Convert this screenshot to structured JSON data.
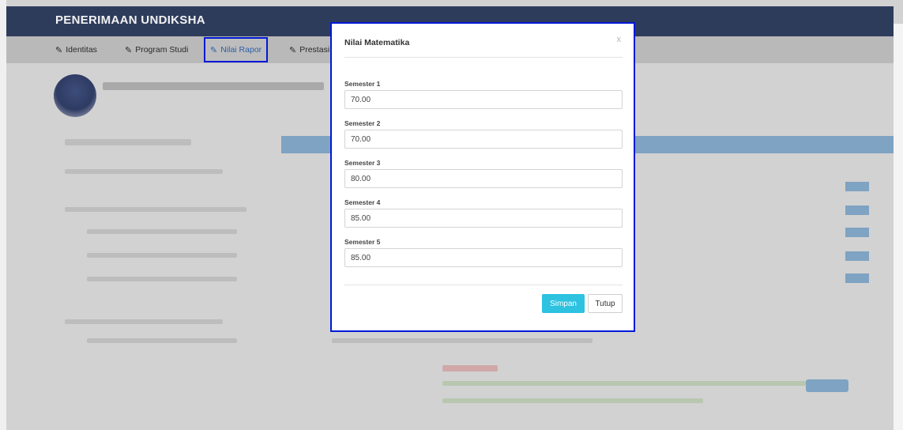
{
  "app": {
    "title": "PENERIMAAN UNDIKSHA"
  },
  "nav": {
    "items": [
      {
        "label": "Identitas",
        "icon": "pencil-icon"
      },
      {
        "label": "Program Studi",
        "icon": "pencil-icon"
      },
      {
        "label": "Nilai Rapor",
        "icon": "pencil-icon",
        "active": true
      },
      {
        "label": "Prestasi",
        "icon": "pencil-icon"
      }
    ]
  },
  "modal": {
    "title": "Nilai Matematika",
    "close_label": "x",
    "fields": [
      {
        "label": "Semester 1",
        "value": "70.00"
      },
      {
        "label": "Semester 2",
        "value": "70.00"
      },
      {
        "label": "Semester 3",
        "value": "80.00"
      },
      {
        "label": "Semester 4",
        "value": "85.00"
      },
      {
        "label": "Semester 5",
        "value": "85.00"
      }
    ],
    "save_label": "Simpan",
    "cancel_label": "Tutup"
  },
  "colors": {
    "navbar": "#2e3c5c",
    "active_outline": "#0018d6",
    "save_button": "#2cc2e0"
  }
}
